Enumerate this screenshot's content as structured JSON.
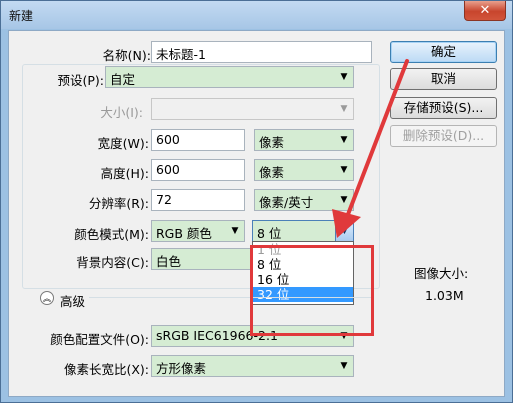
{
  "window": {
    "title": "新建",
    "close_symbol": "✕"
  },
  "form": {
    "name_label": "名称(N):",
    "name_value": "未标题-1",
    "preset_label": "预设(P):",
    "preset_value": "自定",
    "size_label": "大小(I):",
    "size_value": "",
    "width_label": "宽度(W):",
    "width_value": "600",
    "width_unit": "像素",
    "height_label": "高度(H):",
    "height_value": "600",
    "height_unit": "像素",
    "resolution_label": "分辨率(R):",
    "resolution_value": "72",
    "resolution_unit": "像素/英寸",
    "color_mode_label": "颜色模式(M):",
    "color_mode_value": "RGB 颜色",
    "bit_depth_value": "8 位",
    "background_label": "背景内容(C):",
    "background_value": "白色",
    "advanced_label": "高级",
    "color_profile_label": "颜色配置文件(O):",
    "color_profile_value": "sRGB IEC61966-2.1",
    "pixel_aspect_label": "像素长宽比(X):",
    "pixel_aspect_value": "方形像素"
  },
  "bit_depth_options": [
    {
      "label": "1 位",
      "state": "disabled"
    },
    {
      "label": "8 位",
      "state": "normal"
    },
    {
      "label": "16 位",
      "state": "normal"
    },
    {
      "label": "32 位",
      "state": "selected"
    }
  ],
  "buttons": {
    "ok": "确定",
    "cancel": "取消",
    "save_preset": "存储预设(S)...",
    "delete_preset": "删除预设(D)..."
  },
  "image_size": {
    "label": "图像大小:",
    "value": "1.03M"
  },
  "icons": {
    "dropdown": "chevron-down-icon",
    "advanced": "collapse-chevrons-icon",
    "annotation": "red-arrow-annotation"
  },
  "colors": {
    "annotation": "#e0393b",
    "selection": "#3399ff",
    "combo_bg": "#d5ecd3"
  }
}
